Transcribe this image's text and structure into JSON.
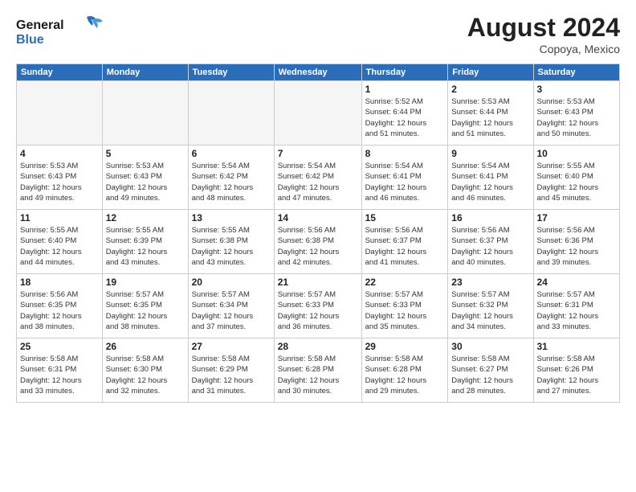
{
  "header": {
    "logo_line1": "General",
    "logo_line2": "Blue",
    "month": "August 2024",
    "location": "Copoya, Mexico"
  },
  "days_of_week": [
    "Sunday",
    "Monday",
    "Tuesday",
    "Wednesday",
    "Thursday",
    "Friday",
    "Saturday"
  ],
  "weeks": [
    [
      {
        "day": "",
        "info": ""
      },
      {
        "day": "",
        "info": ""
      },
      {
        "day": "",
        "info": ""
      },
      {
        "day": "",
        "info": ""
      },
      {
        "day": "1",
        "info": "Sunrise: 5:52 AM\nSunset: 6:44 PM\nDaylight: 12 hours\nand 51 minutes."
      },
      {
        "day": "2",
        "info": "Sunrise: 5:53 AM\nSunset: 6:44 PM\nDaylight: 12 hours\nand 51 minutes."
      },
      {
        "day": "3",
        "info": "Sunrise: 5:53 AM\nSunset: 6:43 PM\nDaylight: 12 hours\nand 50 minutes."
      }
    ],
    [
      {
        "day": "4",
        "info": "Sunrise: 5:53 AM\nSunset: 6:43 PM\nDaylight: 12 hours\nand 49 minutes."
      },
      {
        "day": "5",
        "info": "Sunrise: 5:53 AM\nSunset: 6:43 PM\nDaylight: 12 hours\nand 49 minutes."
      },
      {
        "day": "6",
        "info": "Sunrise: 5:54 AM\nSunset: 6:42 PM\nDaylight: 12 hours\nand 48 minutes."
      },
      {
        "day": "7",
        "info": "Sunrise: 5:54 AM\nSunset: 6:42 PM\nDaylight: 12 hours\nand 47 minutes."
      },
      {
        "day": "8",
        "info": "Sunrise: 5:54 AM\nSunset: 6:41 PM\nDaylight: 12 hours\nand 46 minutes."
      },
      {
        "day": "9",
        "info": "Sunrise: 5:54 AM\nSunset: 6:41 PM\nDaylight: 12 hours\nand 46 minutes."
      },
      {
        "day": "10",
        "info": "Sunrise: 5:55 AM\nSunset: 6:40 PM\nDaylight: 12 hours\nand 45 minutes."
      }
    ],
    [
      {
        "day": "11",
        "info": "Sunrise: 5:55 AM\nSunset: 6:40 PM\nDaylight: 12 hours\nand 44 minutes."
      },
      {
        "day": "12",
        "info": "Sunrise: 5:55 AM\nSunset: 6:39 PM\nDaylight: 12 hours\nand 43 minutes."
      },
      {
        "day": "13",
        "info": "Sunrise: 5:55 AM\nSunset: 6:38 PM\nDaylight: 12 hours\nand 43 minutes."
      },
      {
        "day": "14",
        "info": "Sunrise: 5:56 AM\nSunset: 6:38 PM\nDaylight: 12 hours\nand 42 minutes."
      },
      {
        "day": "15",
        "info": "Sunrise: 5:56 AM\nSunset: 6:37 PM\nDaylight: 12 hours\nand 41 minutes."
      },
      {
        "day": "16",
        "info": "Sunrise: 5:56 AM\nSunset: 6:37 PM\nDaylight: 12 hours\nand 40 minutes."
      },
      {
        "day": "17",
        "info": "Sunrise: 5:56 AM\nSunset: 6:36 PM\nDaylight: 12 hours\nand 39 minutes."
      }
    ],
    [
      {
        "day": "18",
        "info": "Sunrise: 5:56 AM\nSunset: 6:35 PM\nDaylight: 12 hours\nand 38 minutes."
      },
      {
        "day": "19",
        "info": "Sunrise: 5:57 AM\nSunset: 6:35 PM\nDaylight: 12 hours\nand 38 minutes."
      },
      {
        "day": "20",
        "info": "Sunrise: 5:57 AM\nSunset: 6:34 PM\nDaylight: 12 hours\nand 37 minutes."
      },
      {
        "day": "21",
        "info": "Sunrise: 5:57 AM\nSunset: 6:33 PM\nDaylight: 12 hours\nand 36 minutes."
      },
      {
        "day": "22",
        "info": "Sunrise: 5:57 AM\nSunset: 6:33 PM\nDaylight: 12 hours\nand 35 minutes."
      },
      {
        "day": "23",
        "info": "Sunrise: 5:57 AM\nSunset: 6:32 PM\nDaylight: 12 hours\nand 34 minutes."
      },
      {
        "day": "24",
        "info": "Sunrise: 5:57 AM\nSunset: 6:31 PM\nDaylight: 12 hours\nand 33 minutes."
      }
    ],
    [
      {
        "day": "25",
        "info": "Sunrise: 5:58 AM\nSunset: 6:31 PM\nDaylight: 12 hours\nand 33 minutes."
      },
      {
        "day": "26",
        "info": "Sunrise: 5:58 AM\nSunset: 6:30 PM\nDaylight: 12 hours\nand 32 minutes."
      },
      {
        "day": "27",
        "info": "Sunrise: 5:58 AM\nSunset: 6:29 PM\nDaylight: 12 hours\nand 31 minutes."
      },
      {
        "day": "28",
        "info": "Sunrise: 5:58 AM\nSunset: 6:28 PM\nDaylight: 12 hours\nand 30 minutes."
      },
      {
        "day": "29",
        "info": "Sunrise: 5:58 AM\nSunset: 6:28 PM\nDaylight: 12 hours\nand 29 minutes."
      },
      {
        "day": "30",
        "info": "Sunrise: 5:58 AM\nSunset: 6:27 PM\nDaylight: 12 hours\nand 28 minutes."
      },
      {
        "day": "31",
        "info": "Sunrise: 5:58 AM\nSunset: 6:26 PM\nDaylight: 12 hours\nand 27 minutes."
      }
    ]
  ]
}
